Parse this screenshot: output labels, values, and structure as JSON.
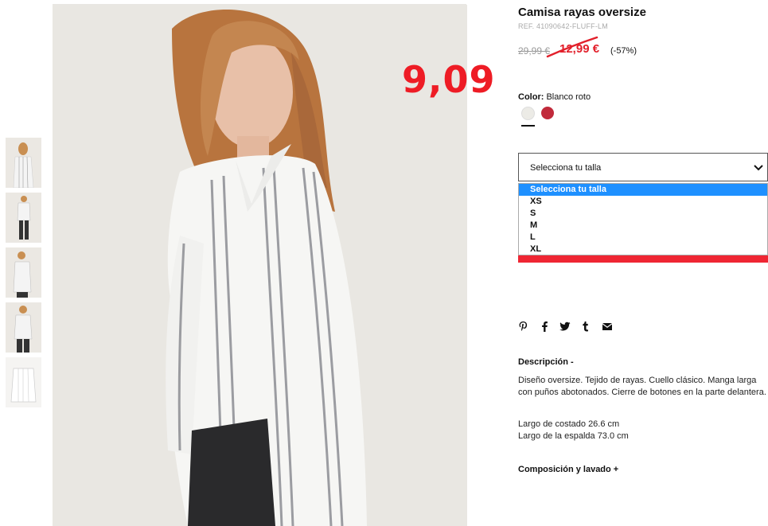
{
  "product": {
    "title": "Camisa rayas oversize",
    "ref": "REF. 41090642-FLUFF-LM",
    "old_price": "29,99 €",
    "sale_price": "12,99 €",
    "discount": "(-57%)"
  },
  "annotation": {
    "handwritten_price": "9,09"
  },
  "color": {
    "label": "Color:",
    "value": "Blanco roto",
    "swatches": [
      {
        "name": "Blanco roto",
        "hex": "#ecebe6"
      },
      {
        "name": "Rojo",
        "hex": "#c12a3b"
      }
    ]
  },
  "size_select": {
    "value": "Selecciona tu talla",
    "options": [
      "Selecciona tu talla",
      "XS",
      "S",
      "M",
      "L",
      "XL"
    ],
    "selected_index": 0
  },
  "share_icons": [
    "pinterest-icon",
    "facebook-icon",
    "twitter-icon",
    "tumblr-icon",
    "email-icon"
  ],
  "description": {
    "heading": "Descripción -",
    "text": "Diseño oversize. Tejido de rayas. Cuello clásico. Manga larga con puños abotonados. Cierre de botones en la parte delantera.",
    "measure1": "Largo de costado 26.6 cm",
    "measure2": "Largo de la espalda 73.0 cm"
  },
  "composition": {
    "heading": "Composición y lavado +"
  },
  "colors": {
    "accent_red": "#e2202b",
    "annotation_red": "#ee1c25",
    "highlight_blue": "#1e90ff"
  }
}
